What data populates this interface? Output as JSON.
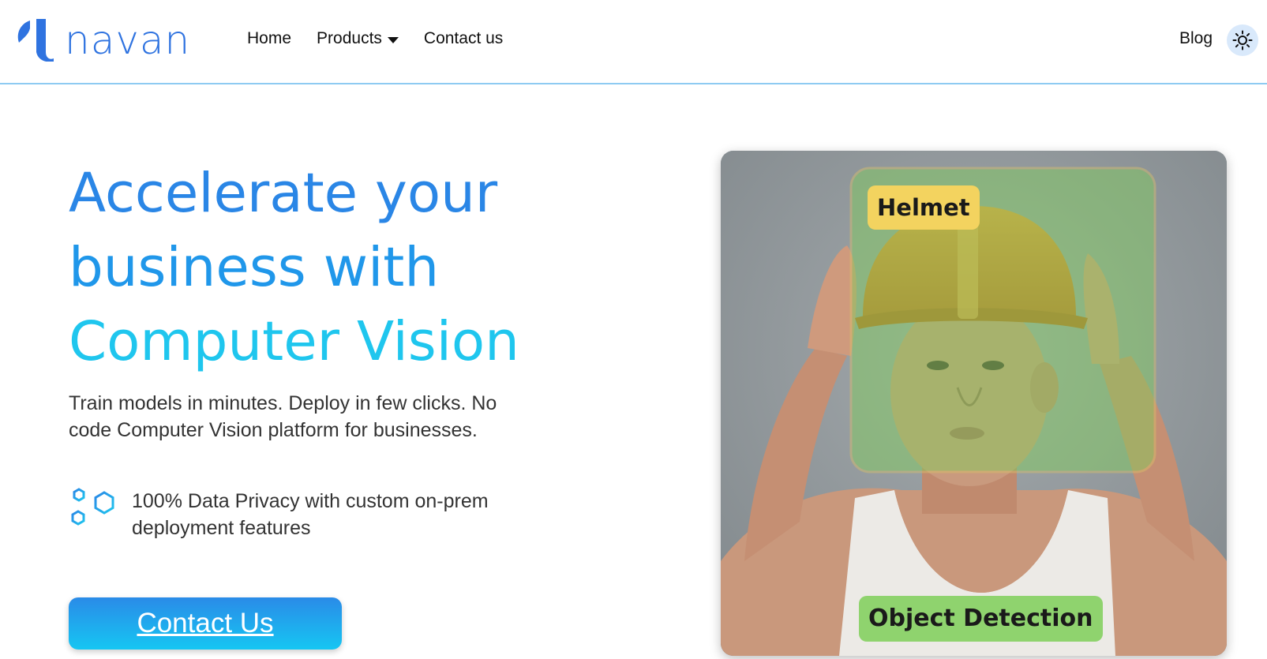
{
  "header": {
    "logo_text": "navan",
    "nav": [
      {
        "label": "Home"
      },
      {
        "label": "Products",
        "has_dropdown": true
      },
      {
        "label": "Contact us"
      }
    ],
    "blog_label": "Blog",
    "theme_icon": "sun-icon"
  },
  "hero": {
    "title_lines": [
      "Accelerate your",
      "business with",
      "Computer Vision"
    ],
    "subtitle": "Train models in minutes. Deploy in few clicks. No code Computer Vision platform for businesses.",
    "feature_icon": "hexagons-icon",
    "feature_text": "100% Data Privacy with custom on-prem deployment features",
    "cta_label": "Contact Us"
  },
  "demo_image": {
    "detection_label": "Helmet",
    "caption": "Object Detection"
  },
  "colors": {
    "brand_blue": "#2f73e0",
    "title_blue": "#2a86e6",
    "title_cyan": "#1fc6ee",
    "helmet_label_bg": "#f3d35f",
    "caption_bg": "#8fd36e"
  }
}
